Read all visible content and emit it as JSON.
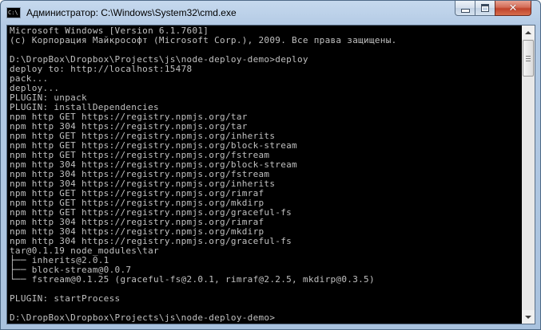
{
  "window": {
    "title": "Администратор: C:\\Windows\\System32\\cmd.exe",
    "icon": "cmd-app-icon",
    "icon_text": "C:\\",
    "buttons": {
      "minimize": "minimize-icon",
      "maximize": "maximize-icon",
      "close": "close-icon",
      "close_glyph": "✕"
    }
  },
  "console": {
    "background": "#000000",
    "foreground": "#c0c0c0",
    "lines": [
      "Microsoft Windows [Version 6.1.7601]",
      "(c) Корпорация Майкрософт (Microsoft Corp.), 2009. Все права защищены.",
      "",
      "D:\\DropBox\\Dropbox\\Projects\\js\\node-deploy-demo>deploy",
      "deploy to: http://localhost:15478",
      "pack...",
      "deploy...",
      "PLUGIN: unpack",
      "PLUGIN: installDependencies",
      "npm http GET https://registry.npmjs.org/tar",
      "npm http 304 https://registry.npmjs.org/tar",
      "npm http GET https://registry.npmjs.org/inherits",
      "npm http GET https://registry.npmjs.org/block-stream",
      "npm http GET https://registry.npmjs.org/fstream",
      "npm http 304 https://registry.npmjs.org/block-stream",
      "npm http 304 https://registry.npmjs.org/fstream",
      "npm http 304 https://registry.npmjs.org/inherits",
      "npm http GET https://registry.npmjs.org/rimraf",
      "npm http GET https://registry.npmjs.org/mkdirp",
      "npm http GET https://registry.npmjs.org/graceful-fs",
      "npm http 304 https://registry.npmjs.org/rimraf",
      "npm http 304 https://registry.npmjs.org/mkdirp",
      "npm http 304 https://registry.npmjs.org/graceful-fs",
      "tar@0.1.19 node_modules\\tar",
      "├── inherits@2.0.1",
      "├── block-stream@0.0.7",
      "└── fstream@0.1.25 (graceful-fs@2.0.1, rimraf@2.2.5, mkdirp@0.3.5)",
      "",
      "PLUGIN: startProcess",
      "",
      "D:\\DropBox\\Dropbox\\Projects\\js\\node-deploy-demo>"
    ]
  },
  "scrollbar": {
    "position_fraction": 0.0,
    "up_arrow": "scroll-up-arrow-icon",
    "down_arrow": "scroll-down-arrow-icon"
  }
}
